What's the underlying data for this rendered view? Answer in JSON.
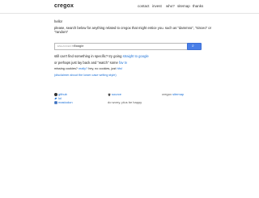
{
  "header": {
    "logo": "cregox",
    "nav": [
      {
        "label": "contact"
      },
      {
        "label": "invest"
      },
      {
        "label": "who?"
      },
      {
        "label": "sitemap"
      },
      {
        "label": "thanks"
      }
    ]
  },
  "main": {
    "hello": "hello!",
    "intro_1": "please, search below for anything related to cregox that might entice you. such as \"dammno\", \"sinceo\" or",
    "intro_2": "\"random\"",
    "search": {
      "placeholder": "ENHANCED BY",
      "brand": "Google",
      "button_icon": "search-icon"
    },
    "still_text": "still can't find something in specific? try going",
    "still_link": "straight to google",
    "relax_text": "or perhaps just lay back and \"watch\" some",
    "relax_link": "fav tv",
    "missing_text": "missing cookies?",
    "missing_link_1": "really?",
    "missing_mid": "hey, no cookies, just",
    "missing_link_2": "hits!",
    "disclaimer": "(disclaimer about the lower case writing style)"
  },
  "footer": {
    "left": [
      {
        "icon": "github-icon",
        "label": "github"
      },
      {
        "icon": "twitter-icon",
        "label": "lol"
      },
      {
        "icon": "mastodon-icon",
        "label": "mastodon"
      }
    ],
    "middle": [
      {
        "icon": "source-icon",
        "label": "source"
      },
      {
        "text": "do worry, plus be happy"
      }
    ],
    "right_text": "cregox",
    "right_link": "sitemap"
  },
  "colors": {
    "link": "#1a6fd6",
    "button": "#4a7fe8"
  }
}
